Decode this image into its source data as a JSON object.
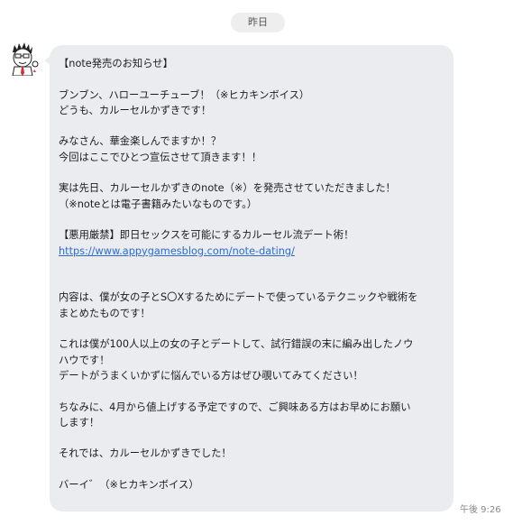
{
  "chat": {
    "date_label": "昨日",
    "timestamp": "午後 9:26",
    "message": {
      "l01": "【note発売のお知らせ】",
      "l02": "ブンブン、ハローユーチューブ！（※ヒカキンボイス）",
      "l03": "どうも、カルーセルかずきです！",
      "l04": "みなさん、華金楽しんでますか！？",
      "l05": "今回はここでひとつ宣伝させて頂きます！！",
      "l06": "実は先日、カルーセルかずきのnote（※）を発売させていただきました！",
      "l07": "（※noteとは電子書籍みたいなものです。）",
      "l08": "【悪用厳禁】即日セックスを可能にするカルーセル流デート術！",
      "link": "https://www.appygamesblog.com/note-dating/",
      "l09": "内容は、僕が女の子とS〇Xするためにデートで使っているテクニックや戦術を",
      "l10": "まとめたものです！",
      "l11": "これは僕が100人以上の女の子とデートして、試行錯誤の末に編み出したノウ",
      "l12": "ハウです！",
      "l13": "デートがうまくいかずに悩んでいる方はぜひ覗いてみてください！",
      "l14": "ちなみに、4月から値上げする予定ですので、ご興味ある方はお早めにお願い",
      "l15": "します！",
      "l16": "それでは、カルーセルかずきでした！",
      "l17": "バーイ゛（※ヒカキンボイス）"
    }
  }
}
